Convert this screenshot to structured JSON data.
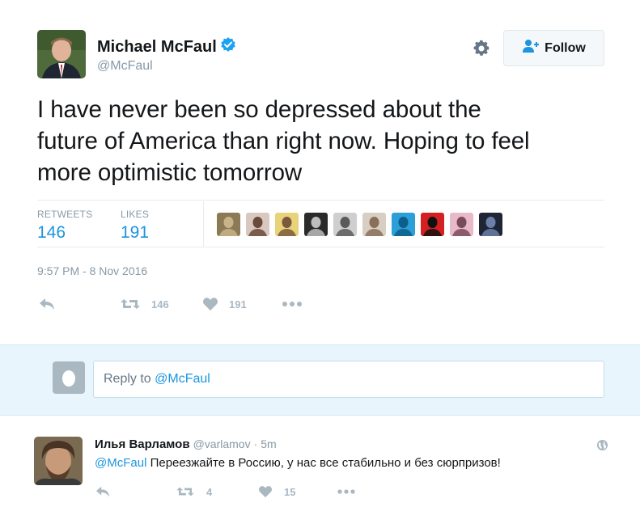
{
  "tweet": {
    "author_name": "Michael McFaul",
    "author_handle": "@McFaul",
    "follow_label": "Follow",
    "text_lines": [
      "I have never been so depressed about the",
      "future of America than right now. Hoping to feel",
      "more optimistic tomorrow"
    ],
    "retweets_label": "RETWEETS",
    "retweets_count": "146",
    "likes_label": "LIKES",
    "likes_count": "191",
    "timestamp": "9:57 PM - 8 Nov 2016",
    "actions": {
      "retweet_count": "146",
      "like_count": "191"
    }
  },
  "likers": [
    {
      "icon": "avatar-crowd",
      "bg": "#8b7a55",
      "fg": "#c9b48a"
    },
    {
      "icon": "avatar-girl-cartoon",
      "bg": "#d9c8c0",
      "fg": "#6a4a3a"
    },
    {
      "icon": "avatar-blonde",
      "bg": "#e8d27a",
      "fg": "#7a5a3a"
    },
    {
      "icon": "avatar-bw-portrait",
      "bg": "#2a2a2a",
      "fg": "#bdbdbd"
    },
    {
      "icon": "avatar-man-glasses",
      "bg": "#cfcfcf",
      "fg": "#5a5a5a"
    },
    {
      "icon": "avatar-woman-glasses",
      "bg": "#d8cfc4",
      "fg": "#8a6f58"
    },
    {
      "icon": "avatar-blue-pattern",
      "bg": "#2a9fd8",
      "fg": "#0d5e8a"
    },
    {
      "icon": "avatar-red-comic",
      "bg": "#d42020",
      "fg": "#111111"
    },
    {
      "icon": "avatar-pink-woman",
      "bg": "#e8b9c9",
      "fg": "#7a4a5a"
    },
    {
      "icon": "avatar-dark-figure",
      "bg": "#1e2535",
      "fg": "#6b7fa8"
    }
  ],
  "reply_box": {
    "prefix": "Reply to ",
    "mention": "@McFaul"
  },
  "reply": {
    "author_name": "Илья Варламов",
    "author_handle": "@varlamov",
    "separator": "·",
    "age": "5m",
    "mention": "@McFaul",
    "text": " Переезжайте в Россию, у нас все стабильно и без сюрпризов!",
    "retweet_count": "4",
    "like_count": "15"
  },
  "colors": {
    "accent": "#1b95e0",
    "verified": "#1da1f2",
    "muted": "#8899a6",
    "action_icon": "#aab8c2",
    "reply_bg": "#e8f5fd"
  }
}
